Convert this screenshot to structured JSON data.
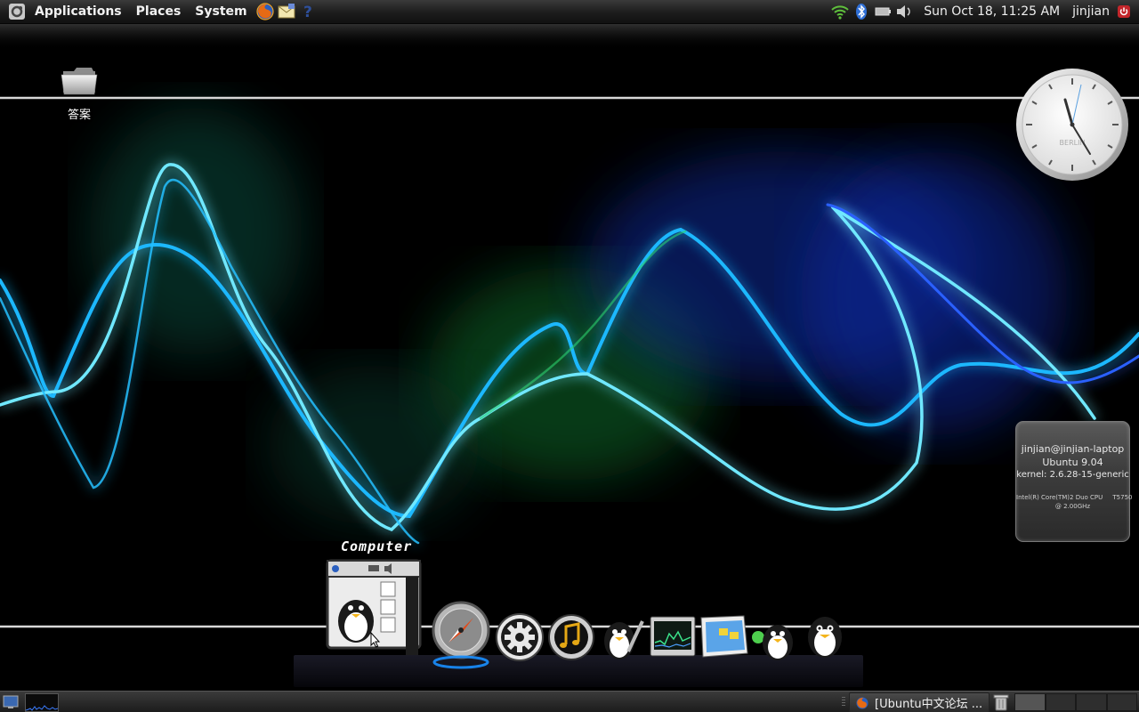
{
  "top_panel": {
    "menus": [
      "Applications",
      "Places",
      "System"
    ],
    "launchers": [
      "firefox-icon",
      "mail-icon",
      "help-icon"
    ],
    "tray_icons": [
      "network-wireless-icon",
      "bluetooth-icon",
      "battery-icon",
      "volume-icon"
    ],
    "datetime": "Sun Oct 18, 11:25 AM",
    "user": "jinjian",
    "session_icon": "shutdown-icon"
  },
  "desktop": {
    "icons": [
      {
        "label": "答案",
        "icon": "folder-icon"
      }
    ]
  },
  "clock_widget": {
    "city": "BERLIN",
    "time": "11:25"
  },
  "sysinfo_widget": {
    "user_host": "jinjian@jinjian-laptop",
    "os": "Ubuntu 9.04",
    "kernel": "kernel: 2.6.28-15-generic",
    "cpu_line1": "Intel(R) Core(TM)2 Duo CPU     T5750",
    "cpu_line2": "@ 2.00GHz"
  },
  "dock": {
    "hover_label": "Computer",
    "items": [
      {
        "name": "computer",
        "icon": "computer-icon"
      },
      {
        "name": "browser",
        "icon": "compass-icon"
      },
      {
        "name": "settings",
        "icon": "gear-icon"
      },
      {
        "name": "music",
        "icon": "music-icon"
      },
      {
        "name": "editor",
        "icon": "tux-pencil-icon"
      },
      {
        "name": "system-monitor",
        "icon": "monitor-icon"
      },
      {
        "name": "file-manager",
        "icon": "folder-window-icon"
      },
      {
        "name": "messenger",
        "icon": "tux-messenger-icon"
      },
      {
        "name": "tux",
        "icon": "tux-icon"
      }
    ]
  },
  "bottom_panel": {
    "task_label": "[Ubuntu中文论坛 ...",
    "workspaces": 4,
    "active_workspace": 1
  },
  "colors": {
    "wave_blue": "#1e5bff",
    "wave_cyan": "#1ec8ff",
    "wave_green": "#1f9a3a",
    "panel": "#262626"
  }
}
